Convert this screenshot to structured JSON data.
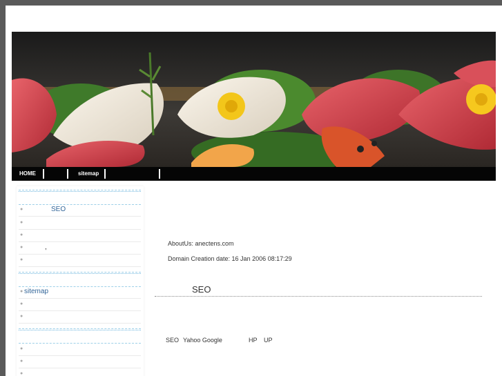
{
  "nav": {
    "home_label": "HOME",
    "sitemap_label": "sitemap"
  },
  "sidebar": {
    "group1": [
      "SEO",
      "",
      "",
      ",",
      ""
    ],
    "group2": [
      "sitemap",
      "",
      ""
    ],
    "group3": [
      "",
      "",
      ""
    ]
  },
  "main": {
    "about": "AboutUs: anectens.com",
    "domain_date": "Domain Creation date: 16 Jan 2006 08:17:29",
    "heading": "SEO",
    "footer_line": {
      "seo": "SEO",
      "engines": "Yahoo Google",
      "hp": "HP",
      "up": "UP"
    }
  },
  "colors": {
    "navbar": "#050505",
    "link": "#336699",
    "divider": "#9ccfe8"
  }
}
